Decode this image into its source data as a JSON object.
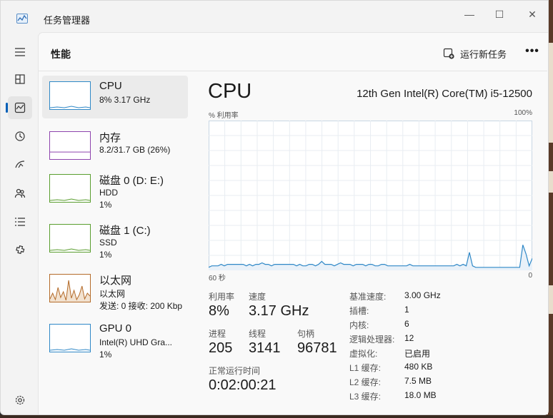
{
  "app": {
    "title": "任务管理器",
    "icon": "chart-app-icon"
  },
  "window_controls": {
    "minimize": "—",
    "maximize": "☐",
    "close": "✕"
  },
  "nav": [
    {
      "name": "hamburger-menu-icon"
    },
    {
      "name": "processes-icon"
    },
    {
      "name": "performance-icon",
      "active": true
    },
    {
      "name": "app-history-icon"
    },
    {
      "name": "startup-apps-icon"
    },
    {
      "name": "users-icon"
    },
    {
      "name": "details-icon"
    },
    {
      "name": "services-icon"
    },
    {
      "name": "settings-icon"
    }
  ],
  "header": {
    "title": "性能",
    "run_task": "运行新任务",
    "more": "•••"
  },
  "resources": [
    {
      "name": "CPU",
      "line2": "8% 3.17 GHz",
      "line3": "",
      "line4": "",
      "color": "#2f88c7"
    },
    {
      "name": "内存",
      "line2": "8.2/31.7 GB (26%)",
      "line3": "",
      "line4": "",
      "color": "#8e44ad",
      "level_pct": 26
    },
    {
      "name": "磁盘 0 (D: E:)",
      "line2": "HDD",
      "line3": "1%",
      "line4": "",
      "color": "#5a9e2f"
    },
    {
      "name": "磁盘 1 (C:)",
      "line2": "SSD",
      "line3": "1%",
      "line4": "",
      "color": "#5a9e2f"
    },
    {
      "name": "以太网",
      "line2": "以太网",
      "line3": "发送: 0 接收: 200 Kbp",
      "line4": "",
      "color": "#b46b2a"
    },
    {
      "name": "GPU 0",
      "line2": "Intel(R) UHD Gra...",
      "line3": "1%",
      "line4": "",
      "color": "#2f88c7"
    }
  ],
  "cpu": {
    "title": "CPU",
    "model": "12th Gen Intel(R) Core(TM) i5-12500",
    "y_label": "% 利用率",
    "y_max": "100%",
    "x_left": "60 秒",
    "x_right": "0",
    "usage_history": [
      2,
      3,
      3,
      3,
      4,
      3,
      4,
      4,
      4,
      4,
      4,
      4,
      3,
      4,
      3,
      4,
      4,
      5,
      4,
      4,
      3,
      4,
      4,
      4,
      4,
      4,
      4,
      4,
      3,
      4,
      3,
      3,
      4,
      4,
      3,
      4,
      6,
      4,
      4,
      4,
      3,
      4,
      5,
      4,
      4,
      4,
      3,
      4,
      4,
      4,
      3,
      4,
      4,
      3,
      3,
      4,
      4,
      3,
      3,
      3,
      3,
      3,
      3,
      3,
      4,
      3,
      3,
      3,
      3,
      3,
      3,
      3,
      3,
      3,
      3,
      3,
      3,
      3,
      3,
      4,
      3,
      4,
      3,
      12,
      3,
      2,
      2,
      2,
      2,
      2,
      2,
      2,
      2,
      2,
      2,
      2,
      2,
      2,
      2,
      2,
      17,
      11,
      3,
      8
    ],
    "stats": {
      "util_label": "利用率",
      "util_value": "8%",
      "speed_label": "速度",
      "speed_value": "3.17 GHz",
      "proc_label": "进程",
      "proc_value": "205",
      "thread_label": "线程",
      "thread_value": "3141",
      "handle_label": "句柄",
      "handle_value": "96781",
      "uptime_label": "正常运行时间",
      "uptime_value": "0:02:00:21"
    },
    "details": [
      {
        "k": "基准速度:",
        "v": "3.00 GHz"
      },
      {
        "k": "插槽:",
        "v": "1"
      },
      {
        "k": "内核:",
        "v": "6"
      },
      {
        "k": "逻辑处理器:",
        "v": "12"
      },
      {
        "k": "虚拟化:",
        "v": "已启用"
      },
      {
        "k": "L1 缓存:",
        "v": "480 KB"
      },
      {
        "k": "L2 缓存:",
        "v": "7.5 MB"
      },
      {
        "k": "L3 缓存:",
        "v": "18.0 MB"
      }
    ]
  },
  "colors": {
    "accent": "#005fb8",
    "cpu_line": "#2f88c7",
    "cpu_fill": "#e9f1f9",
    "grid": "#e8edf2"
  }
}
